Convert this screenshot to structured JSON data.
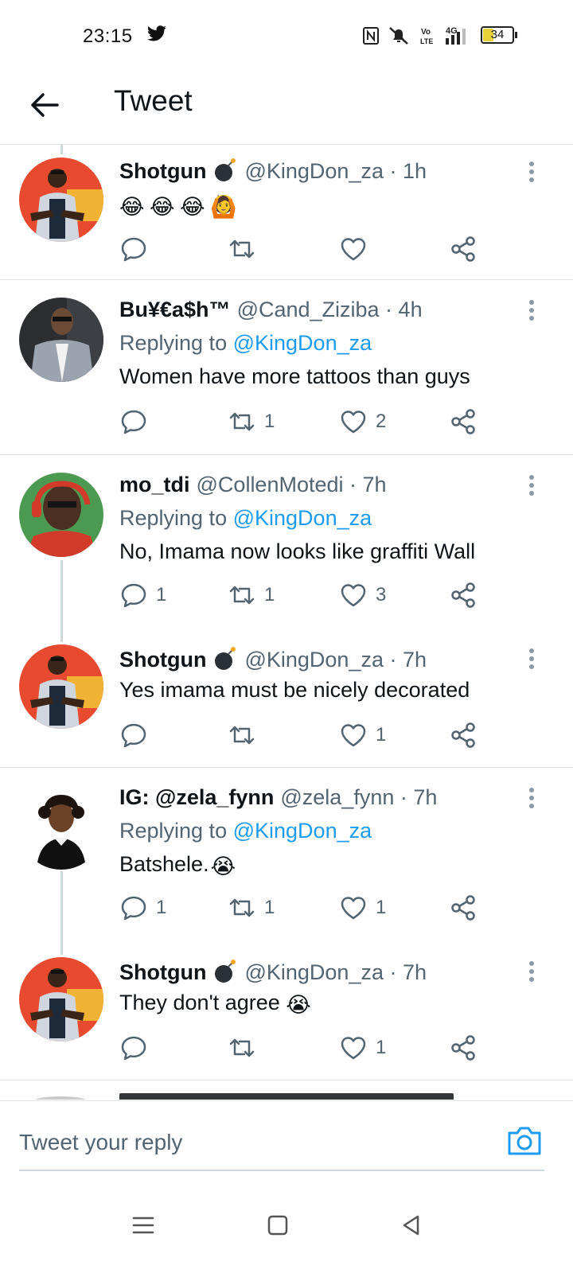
{
  "status_bar": {
    "time": "23:15",
    "battery": "34",
    "icons": [
      "twitter-icon",
      "nfc-icon",
      "mute-icon",
      "volte-icon",
      "4g-signal-icon",
      "battery-icon"
    ]
  },
  "header": {
    "title": "Tweet"
  },
  "tweets": [
    {
      "name": "Shotgun",
      "handle": "@KingDon_za · 1h",
      "text": "",
      "emojis": [
        "😂",
        "😂",
        "😂",
        "🙆"
      ],
      "replies": "",
      "retweets": "",
      "likes": ""
    },
    {
      "name": "Bu¥€a$h™",
      "handle": "@Cand_Ziziba · 4h",
      "replying_prefix": "Replying to",
      "replying_to": "@KingDon_za",
      "text": "Women have more tattoos than guys",
      "replies": "",
      "retweets": "1",
      "likes": "2"
    },
    {
      "name": "mo_tdi",
      "handle": "@CollenMotedi · 7h",
      "replying_prefix": "Replying to",
      "replying_to": "@KingDon_za",
      "text": "No, Imama now looks like graffiti Wall",
      "replies": "1",
      "retweets": "1",
      "likes": "3"
    },
    {
      "name": "Shotgun",
      "handle": "@KingDon_za · 7h",
      "text": "Yes imama must be nicely decorated",
      "replies": "",
      "retweets": "",
      "likes": "1"
    },
    {
      "name": "IG: @zela_fynn",
      "handle": "@zela_fynn · 7h",
      "replying_prefix": "Replying to",
      "replying_to": "@KingDon_za",
      "text": "Batshele.",
      "emoji_after": "😭",
      "replies": "1",
      "retweets": "1",
      "likes": "1"
    },
    {
      "name": "Shotgun",
      "handle": "@KingDon_za · 7h",
      "text": "They don't agree ",
      "emoji_after": "😭",
      "replies": "",
      "retweets": "",
      "likes": "1"
    }
  ],
  "reply_bar": {
    "placeholder": "Tweet your reply"
  },
  "colors": {
    "link": "#1d9bf0",
    "secondary": "#536471",
    "divider": "#e1e5e8"
  }
}
